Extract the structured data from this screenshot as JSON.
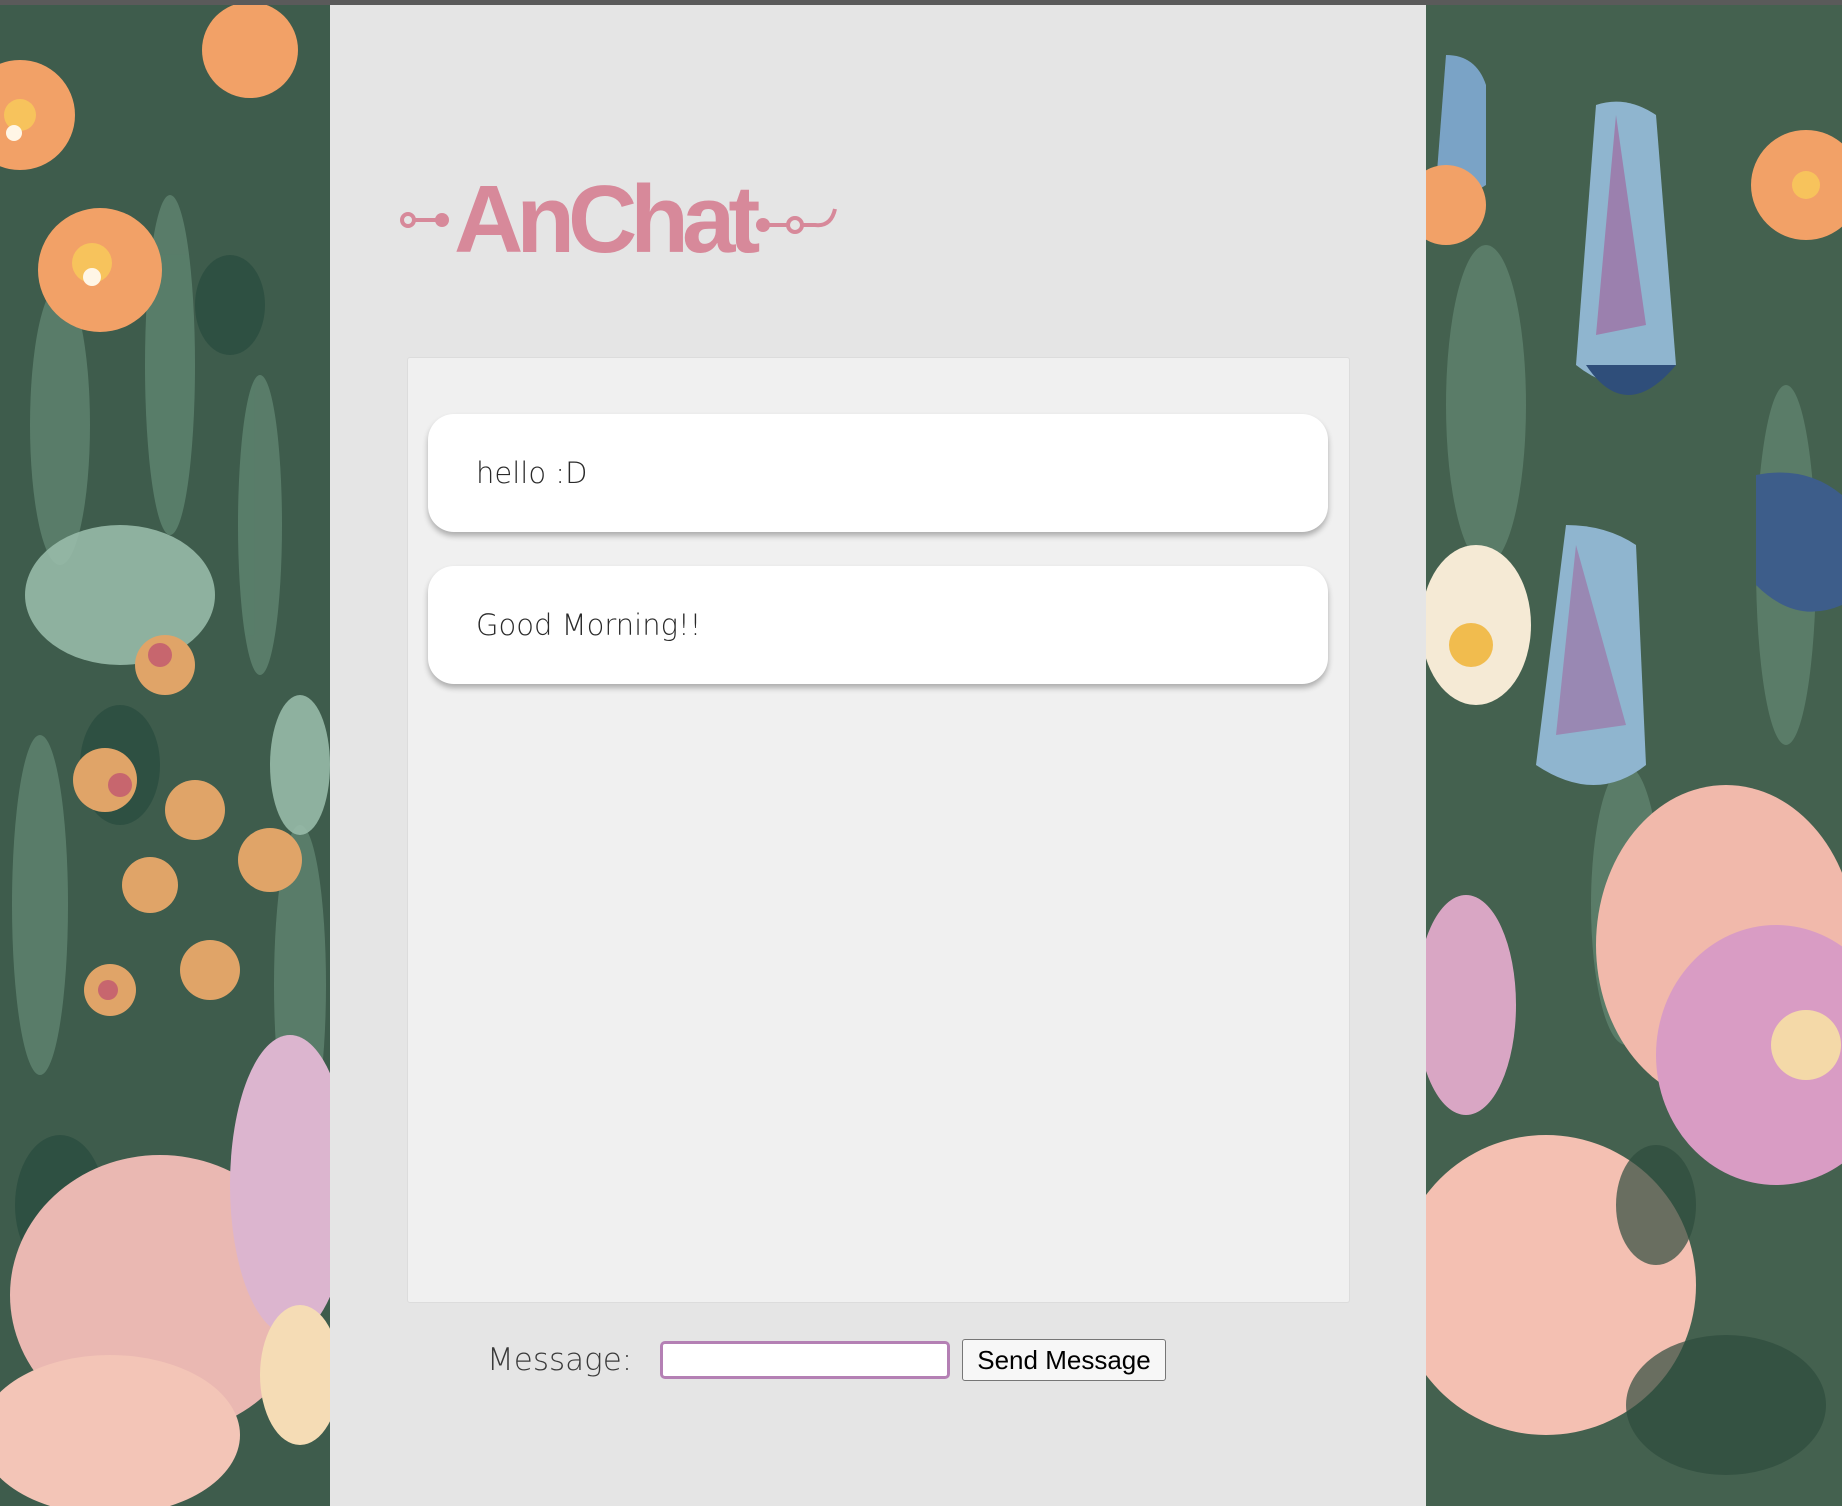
{
  "app": {
    "title": "AnChat",
    "accent_color": "#d7899a"
  },
  "chat": {
    "messages": [
      {
        "text": "hello :D"
      },
      {
        "text": "Good Morning!!"
      }
    ]
  },
  "composer": {
    "label": "Message:",
    "input_value": "",
    "send_label": "Send Message",
    "input_border_color": "#b480b4"
  },
  "background": {
    "description_icon": "floral-painting"
  }
}
